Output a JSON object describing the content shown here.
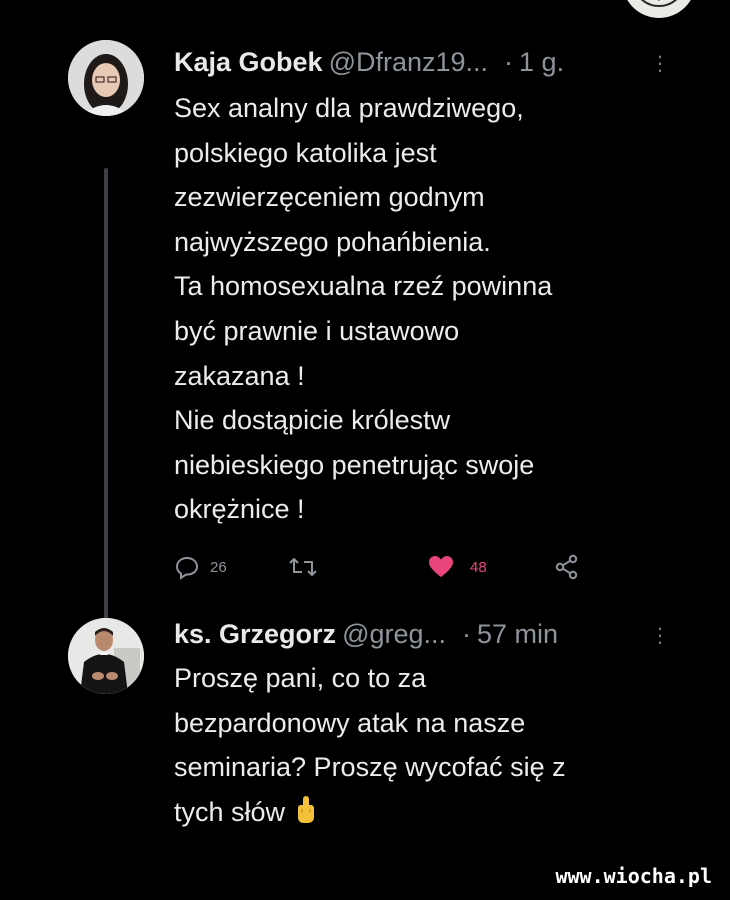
{
  "tweets": [
    {
      "name": "Kaja Gobek",
      "handle": "@Dfranz19...",
      "separator": "·",
      "time": "1 g.",
      "more_icon": "more-vertical-icon",
      "lines": [
        "Sex analny dla prawdziwego,",
        "polskiego katolika jest",
        "zezwierzęceniem godnym",
        "najwyższego pohańbienia.",
        "Ta homosexualna rzeź powinna",
        "być prawnie i ustawowo",
        "zakazana !",
        "Nie dostąpicie królestw",
        "niebieskiego penetrując swoje",
        "okrężnice !"
      ],
      "actions": {
        "reply_count": "26",
        "retweet_count": "",
        "like_count": "48",
        "share": ""
      }
    },
    {
      "name": "ks. Grzegorz",
      "handle": "@greg...",
      "separator": "·",
      "time": "57 min",
      "more_icon": "more-vertical-icon",
      "lines": [
        "Proszę pani, co to za",
        "bezpardonowy atak na nasze",
        "seminaria? Proszę wycofać się z",
        "tych słów"
      ],
      "emoji": "middle-finger-emoji"
    }
  ],
  "watermark": "www.wiocha.pl",
  "colors": {
    "background": "#000000",
    "text": "#ececec",
    "muted": "#8d949a",
    "like": "#e9457d",
    "thread_line": "#3d4045"
  }
}
